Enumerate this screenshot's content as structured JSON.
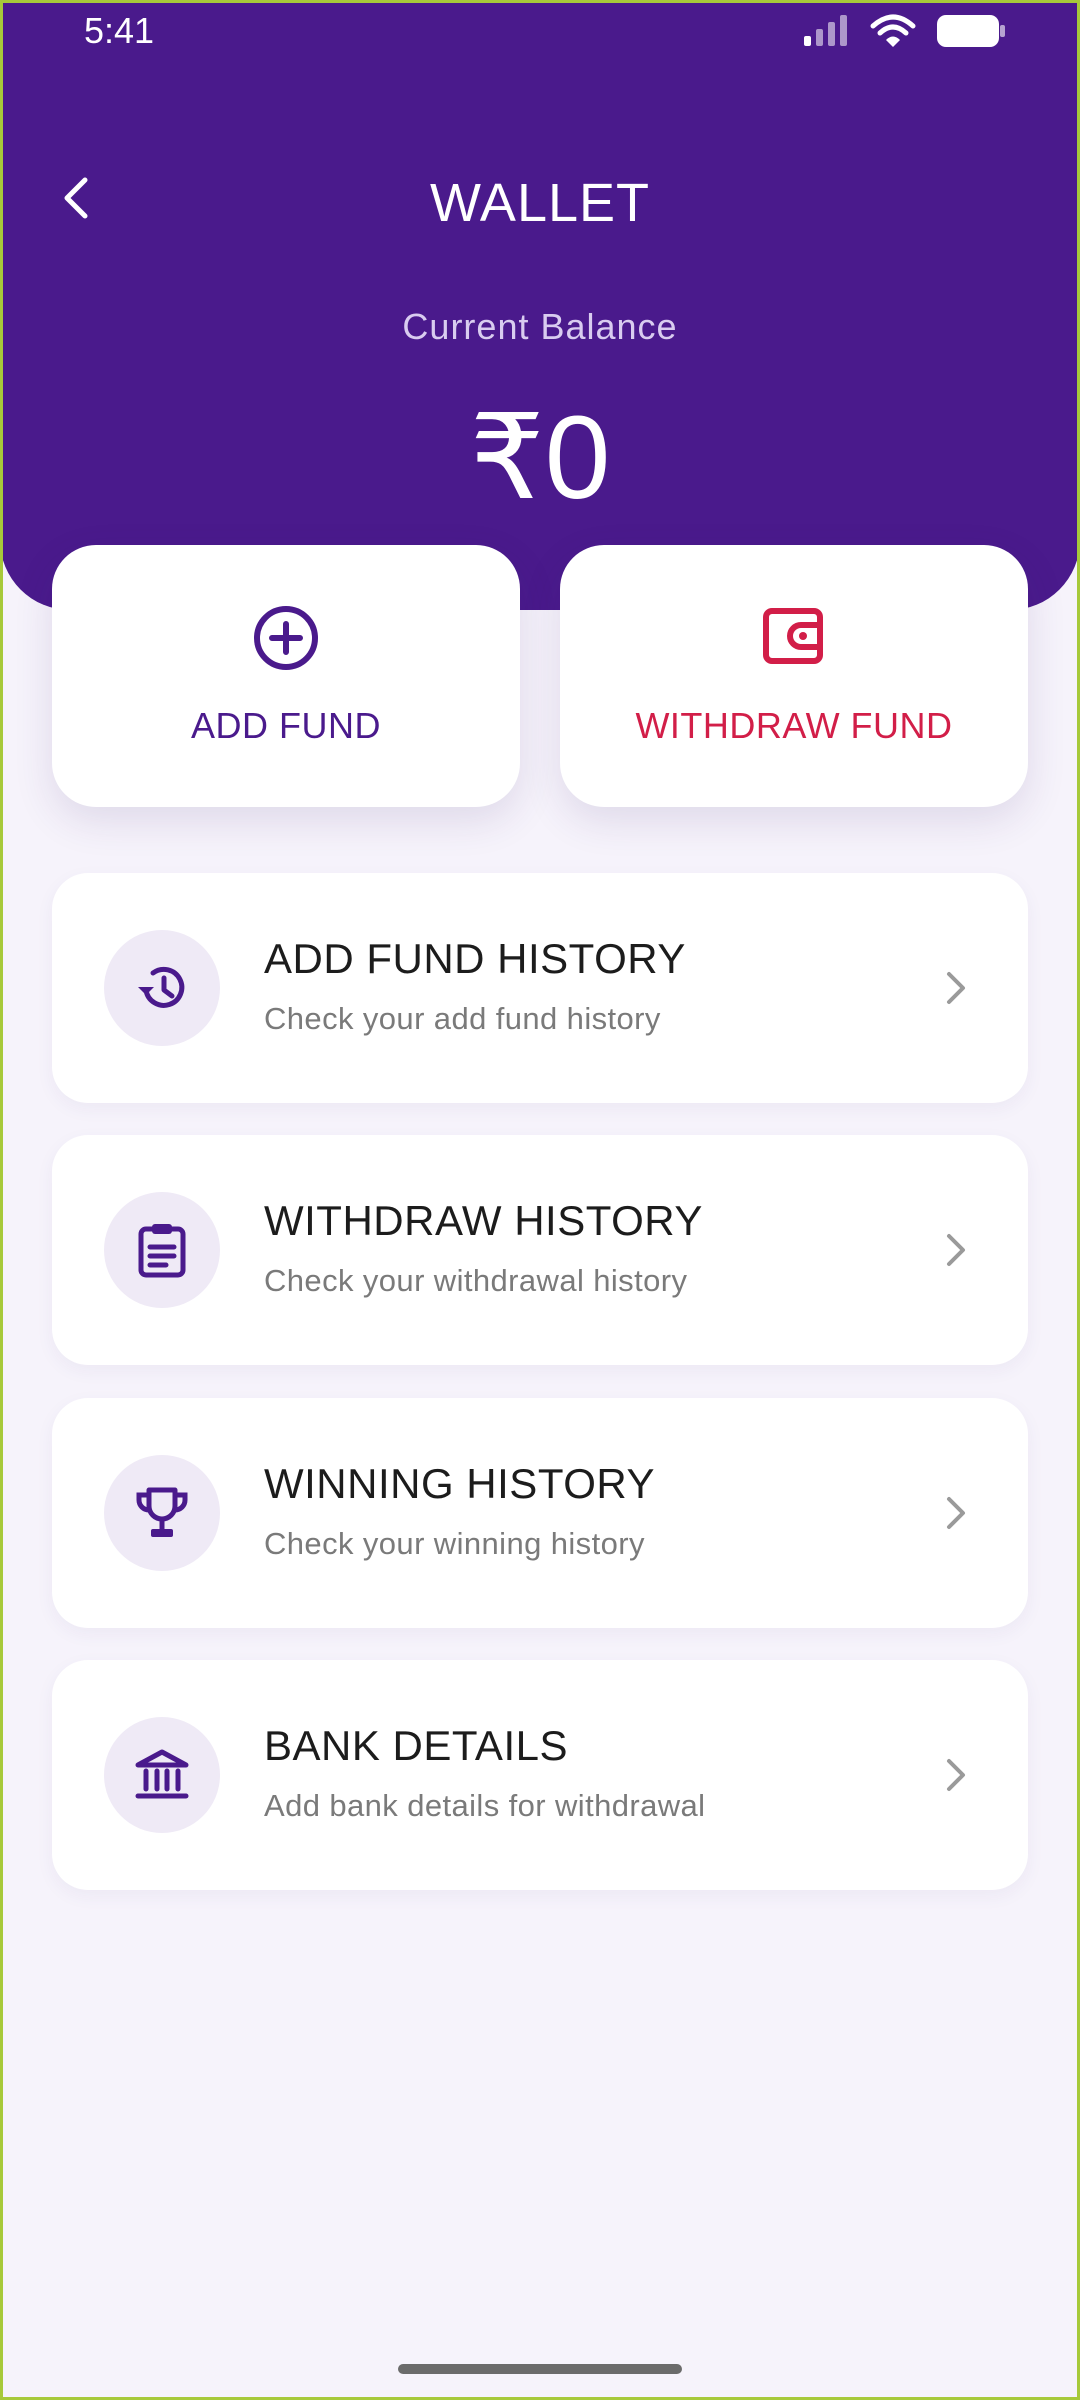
{
  "status": {
    "time": "5:41"
  },
  "header": {
    "title": "WALLET",
    "balance_label": "Current Balance",
    "balance_value": "₹0"
  },
  "actions": {
    "add_fund": "ADD FUND",
    "withdraw_fund": "WITHDRAW FUND"
  },
  "menu": [
    {
      "title": "ADD FUND HISTORY",
      "subtitle": "Check your add fund history",
      "icon": "history-icon"
    },
    {
      "title": "WITHDRAW HISTORY",
      "subtitle": "Check your withdrawal history",
      "icon": "clipboard-icon"
    },
    {
      "title": "WINNING HISTORY",
      "subtitle": "Check your winning history",
      "icon": "trophy-icon"
    },
    {
      "title": "BANK DETAILS",
      "subtitle": "Add bank details for withdrawal",
      "icon": "bank-icon"
    }
  ],
  "colors": {
    "brand": "#4a1a8c",
    "withdraw": "#d21e48",
    "background": "#f6f3fb"
  }
}
